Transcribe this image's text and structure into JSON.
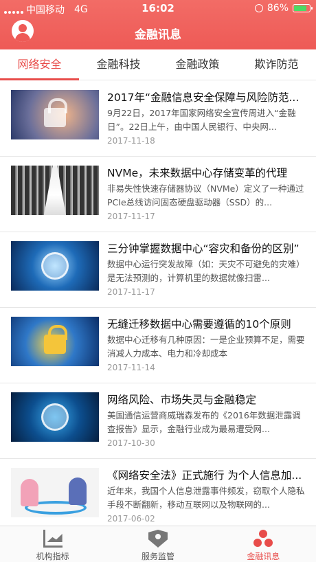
{
  "status_bar": {
    "carrier": "中国移动",
    "network": "4G",
    "time": "16:02",
    "battery": "86%",
    "battery_level": 0.86
  },
  "nav": {
    "title": "金融讯息"
  },
  "tabs": [
    {
      "label": "网络安全",
      "active": true
    },
    {
      "label": "金融科技",
      "active": false
    },
    {
      "label": "金融政策",
      "active": false
    },
    {
      "label": "欺诈防范",
      "active": false
    }
  ],
  "articles": [
    {
      "title": "2017年“金融信息安全保障与风险防范...",
      "desc": "9月22日，2017年国家网络安全宣传周进入“金融日”。22日上午，由中国人民银行、中央网...",
      "date": "2017-11-18",
      "thumb": "lock-warm"
    },
    {
      "title": "NVMe，未来数据中心存储变革的代理",
      "desc": "非易失性快速存储器协议（NVMe）定义了一种通过PCIe总线访问固态硬盘驱动器（SSD）的...",
      "date": "2017-11-17",
      "thumb": "server-aisle"
    },
    {
      "title": "三分钟掌握数据中心“容灾和备份的区别”",
      "desc": "数据中心运行突发故障（如：天灾不可避免的灾难）是无法预测的，计算机里的数据就像扫雷...",
      "date": "2017-11-17",
      "thumb": "circuit-lock"
    },
    {
      "title": "无缝迁移数据中心需要遵循的10个原则",
      "desc": "数据中心迁移有几种原因：一是企业预算不足，需要消减人力成本、电力和冷却成本",
      "date": "2017-11-14",
      "thumb": "gold-lock"
    },
    {
      "title": "网络风险、市场失灵与金融稳定",
      "desc": "美国通信运营商威瑞森发布的《2016年数据泄露调查报告》显示，金融行业成为最易遭受网...",
      "date": "2017-10-30",
      "thumb": "dark-lock"
    },
    {
      "title": "《网络安全法》正式施行 为个人信息加...",
      "desc": "近年来，我国个人信息泄露事件频发，窃取个人隐私手段不断翻新，移动互联网以及物联网的...",
      "date": "2017-06-02",
      "thumb": "cartoon"
    }
  ],
  "bottom_tabs": [
    {
      "label": "机构指标",
      "icon": "chart-icon",
      "active": false
    },
    {
      "label": "服务监管",
      "icon": "shield-icon",
      "active": false
    },
    {
      "label": "金融讯息",
      "icon": "finance-icon",
      "active": true
    }
  ],
  "colors": {
    "brand": "#ee5a56",
    "active": "#e84c4a",
    "battery": "#4cd964"
  }
}
